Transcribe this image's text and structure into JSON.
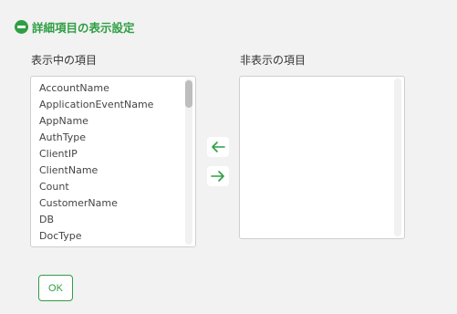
{
  "section": {
    "title": "詳細項目の表示設定",
    "icon": "minus-circle-icon"
  },
  "visible_list": {
    "label": "表示中の項目",
    "items": [
      "AccountName",
      "ApplicationEventName",
      "AppName",
      "AuthType",
      "ClientIP",
      "ClientName",
      "Count",
      "CustomerName",
      "DB",
      "DocType",
      "…"
    ]
  },
  "hidden_list": {
    "label": "非表示の項目",
    "items": []
  },
  "buttons": {
    "move_left_icon": "arrow-left-icon",
    "move_right_icon": "arrow-right-icon",
    "ok": "OK"
  },
  "colors": {
    "accent": "#2f9e44",
    "background": "#f2f2f2",
    "list_bg": "#ffffff",
    "border": "#cfcfcf"
  }
}
